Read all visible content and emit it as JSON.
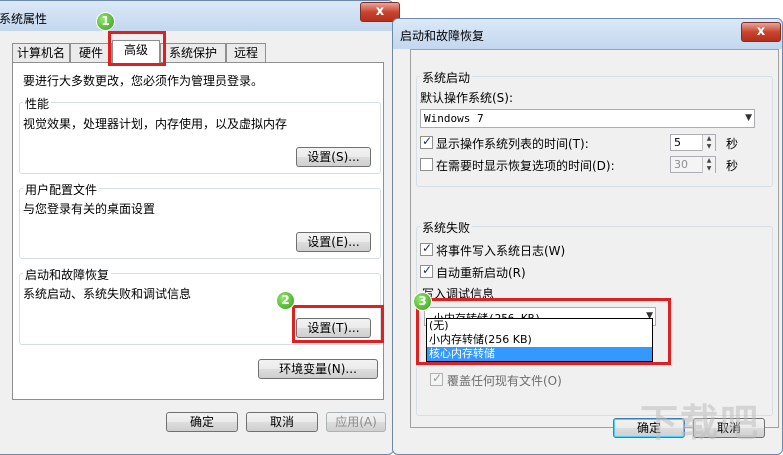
{
  "left_window": {
    "title": "系统属性",
    "close": "x",
    "tabs": [
      "计算机名",
      "硬件",
      "高级",
      "系统保护",
      "远程"
    ],
    "admin_note": "要进行大多数更改，您必须作为管理员登录。",
    "performance": {
      "title": "性能",
      "desc": "视觉效果，处理器计划，内存使用，以及虚拟内存",
      "button": "设置(S)..."
    },
    "user_profiles": {
      "title": "用户配置文件",
      "desc": "与您登录有关的桌面设置",
      "button": "设置(E)..."
    },
    "startup_recovery": {
      "title": "启动和故障恢复",
      "desc": "系统启动、系统失败和调试信息",
      "button": "设置(T)..."
    },
    "env_button": "环境变量(N)...",
    "ok": "确定",
    "cancel": "取消",
    "apply": "应用(A)"
  },
  "right_window": {
    "title": "启动和故障恢复",
    "close": "x",
    "system_startup": {
      "title": "系统启动",
      "default_os_label": "默认操作系统(S):",
      "default_os_value": "Windows 7",
      "show_os_list_label": "显示操作系统列表的时间(T):",
      "show_os_list_value": "5",
      "show_recovery_label": "在需要时显示恢复选项的时间(D):",
      "show_recovery_value": "30",
      "unit": "秒"
    },
    "system_failure": {
      "title": "系统失败",
      "write_event_label": "将事件写入系统日志(W)",
      "auto_restart_label": "自动重新启动(R)",
      "debug_info_title": "写入调试信息",
      "debug_selected": "小内存转储(256 KB)",
      "debug_options": [
        "(无)",
        "小内存转储(256 KB)",
        "核心内存转储"
      ],
      "overwrite_label": "覆盖任何现有文件(O)"
    },
    "ok": "确定",
    "cancel": "取消"
  },
  "badges": [
    "1",
    "2",
    "3"
  ],
  "watermark": "下载吧"
}
